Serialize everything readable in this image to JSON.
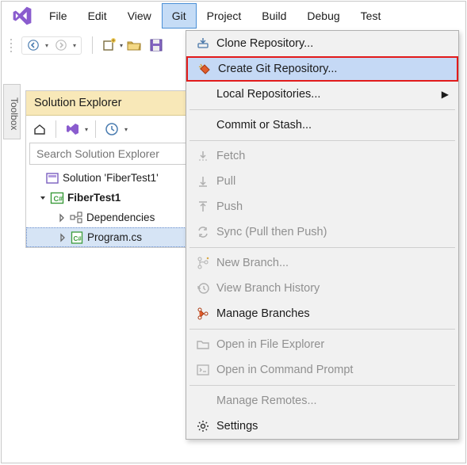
{
  "menubar": {
    "items": [
      "File",
      "Edit",
      "View",
      "Git",
      "Project",
      "Build",
      "Debug",
      "Test"
    ],
    "open_index": 3
  },
  "toolbox_label": "Toolbox",
  "solution_explorer": {
    "title": "Solution Explorer",
    "search_placeholder": "Search Solution Explorer",
    "tree": {
      "solution": "Solution 'FiberTest1'",
      "project": "FiberTest1",
      "dependencies": "Dependencies",
      "file": "Program.cs"
    }
  },
  "git_menu": {
    "items": [
      {
        "label": "Clone Repository...",
        "icon": "clone-icon",
        "enabled": true,
        "highlight": false,
        "callout": false
      },
      {
        "label": "Create Git Repository...",
        "icon": "create-repo-icon",
        "enabled": true,
        "highlight": true,
        "callout": true
      },
      {
        "label": "Local Repositories...",
        "icon": null,
        "enabled": true,
        "highlight": false,
        "submenu": true
      },
      {
        "sep": true
      },
      {
        "label": "Commit or Stash...",
        "icon": null,
        "enabled": true,
        "highlight": false
      },
      {
        "sep": true
      },
      {
        "label": "Fetch",
        "icon": "fetch-icon",
        "enabled": false
      },
      {
        "label": "Pull",
        "icon": "pull-icon",
        "enabled": false
      },
      {
        "label": "Push",
        "icon": "push-icon",
        "enabled": false
      },
      {
        "label": "Sync (Pull then Push)",
        "icon": "sync-icon",
        "enabled": false
      },
      {
        "sep": true
      },
      {
        "label": "New Branch...",
        "icon": "new-branch-icon",
        "enabled": false
      },
      {
        "label": "View Branch History",
        "icon": "history-icon",
        "enabled": false
      },
      {
        "label": "Manage Branches",
        "icon": "branches-icon",
        "enabled": true
      },
      {
        "sep": true
      },
      {
        "label": "Open in File Explorer",
        "icon": "folder-icon",
        "enabled": false
      },
      {
        "label": "Open in Command Prompt",
        "icon": "cmd-icon",
        "enabled": false
      },
      {
        "sep": true
      },
      {
        "label": "Manage Remotes...",
        "icon": null,
        "enabled": false
      },
      {
        "label": "Settings",
        "icon": "settings-icon",
        "enabled": true
      }
    ]
  }
}
